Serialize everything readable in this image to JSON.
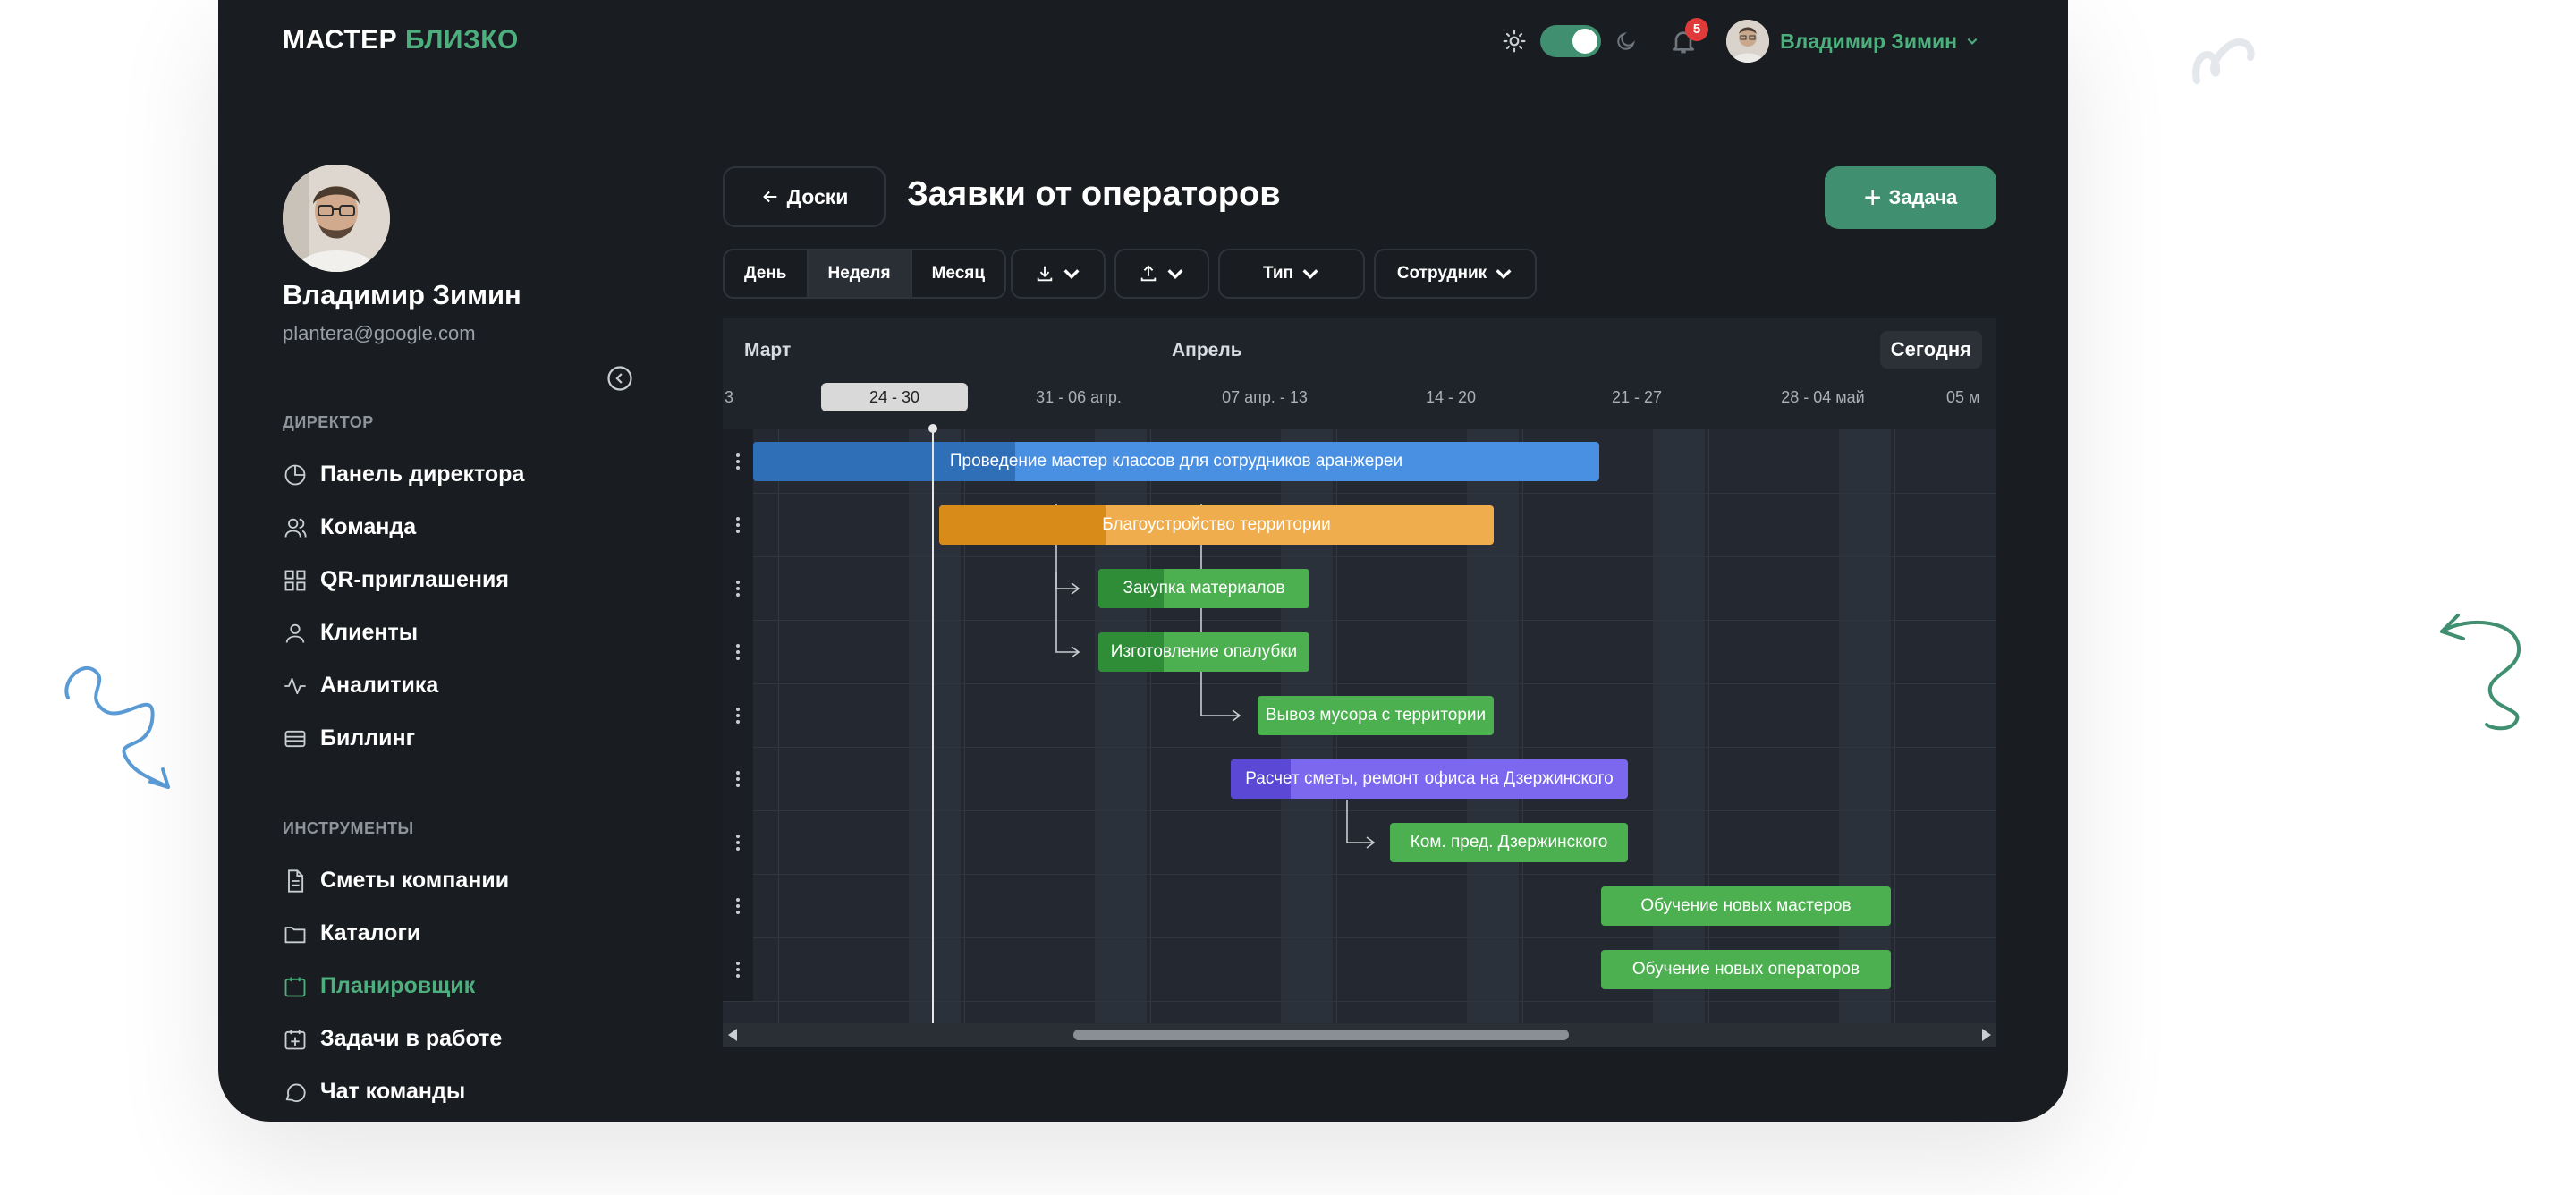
{
  "app": {
    "logo_part1": "МАСТЕР",
    "logo_part2": "БЛИЗКО",
    "notifications_count": "5",
    "user_name": "Владимир Зимин"
  },
  "profile": {
    "name": "Владимир Зимин",
    "email": "plantera@google.com"
  },
  "sidebar": {
    "section1": "ДИРЕКТОР",
    "items1": [
      {
        "label": "Панель директора",
        "icon": "pie-chart-icon"
      },
      {
        "label": "Команда",
        "icon": "users-icon"
      },
      {
        "label": "QR-приглашения",
        "icon": "grid-icon"
      },
      {
        "label": "Клиенты",
        "icon": "user-icon"
      },
      {
        "label": "Аналитика",
        "icon": "activity-icon"
      },
      {
        "label": "Биллинг",
        "icon": "card-icon"
      }
    ],
    "section2": "ИНСТРУМЕНТЫ",
    "items2": [
      {
        "label": "Сметы компании",
        "icon": "document-icon"
      },
      {
        "label": "Каталоги",
        "icon": "folder-icon"
      },
      {
        "label": "Планировщик",
        "icon": "calendar-icon",
        "active": true
      },
      {
        "label": "Задачи в работе",
        "icon": "calendar-plus-icon"
      },
      {
        "label": "Чат команды",
        "icon": "chat-icon"
      }
    ]
  },
  "header": {
    "back_label": "Доски",
    "title": "Заявки от операторов",
    "add_task_label": "Задача"
  },
  "toolbar": {
    "view_day": "День",
    "view_week": "Неделя",
    "view_month": "Месяц",
    "type_label": "Тип",
    "employee_label": "Сотрудник"
  },
  "gantt": {
    "month1": "Март",
    "month2": "Апрель",
    "today_label": "Сегодня",
    "weeks": [
      "3",
      "24 - 30",
      "31 - 06 апр.",
      "07 апр. - 13",
      "14 - 20",
      "21 - 27",
      "28 - 04 май",
      "05 м"
    ],
    "tasks": [
      {
        "label": "Проведение мастер классов для сотрудников аранжереи",
        "color": "#4a90e2",
        "progress_color": "#2f6fb8",
        "progress": 0.31
      },
      {
        "label": "Благоустройство территории",
        "color": "#f0ad4e",
        "progress_color": "#d98b1a",
        "progress": 0.3
      },
      {
        "label": "Закупка материалов",
        "color": "#4caf50",
        "progress_color": "#2f8d38",
        "progress": 0.31
      },
      {
        "label": "Изготовление опалубки",
        "color": "#4caf50",
        "progress_color": "#2f8d38",
        "progress": 0.31
      },
      {
        "label": "Вывоз мусора с территории",
        "color": "#4caf50",
        "progress_color": "#2f8d38",
        "progress": 0
      },
      {
        "label": "Расчет сметы, ремонт офиса на Дзержинского",
        "color": "#7b68ee",
        "progress_color": "#5b49d6",
        "progress": 0.15
      },
      {
        "label": "Ком. пред. Дзержинского",
        "color": "#4caf50",
        "progress_color": "#2f8d38",
        "progress": 0
      },
      {
        "label": "Обучение новых мастеров",
        "color": "#4caf50",
        "progress_color": "#2f8d38",
        "progress": 0
      },
      {
        "label": "Обучение новых операторов",
        "color": "#4caf50",
        "progress_color": "#2f8d38",
        "progress": 0
      }
    ]
  },
  "colors": {
    "accent": "#4caf7d",
    "background": "#191c20",
    "badge": "#e03b3b"
  }
}
